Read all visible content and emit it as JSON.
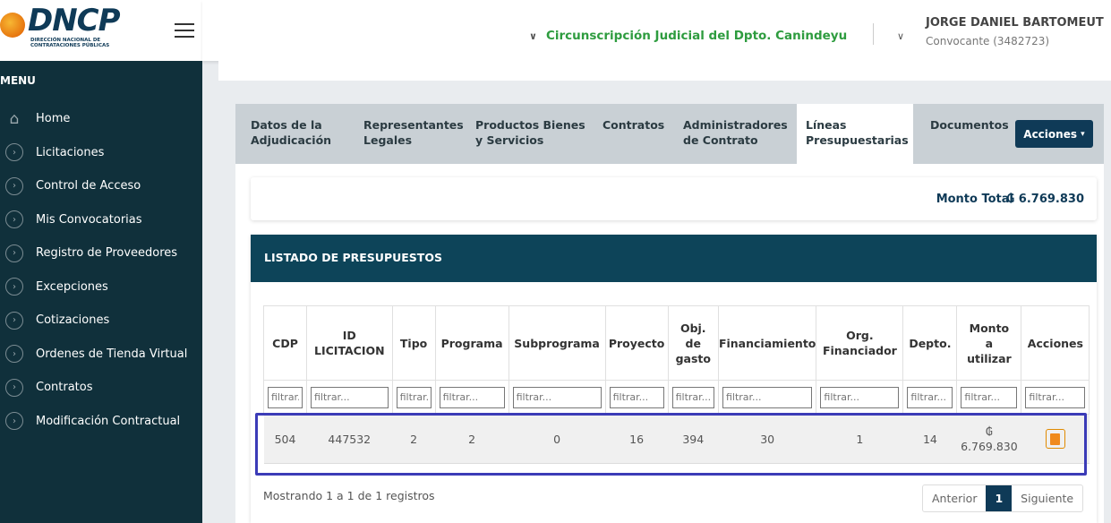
{
  "logo": {
    "title": "DNCP",
    "subtitle_line1": "DIRECCIÓN NACIONAL DE",
    "subtitle_line2": "CONTRATACIONES PÚBLICAS"
  },
  "sidebar": {
    "menu_label": "MENU",
    "items": [
      {
        "label": "Home",
        "icon": "home-icon"
      },
      {
        "label": "Licitaciones",
        "icon": "chevron-circle-icon"
      },
      {
        "label": "Control de Acceso",
        "icon": "chevron-circle-icon"
      },
      {
        "label": "Mis Convocatorias",
        "icon": "chevron-circle-icon"
      },
      {
        "label": "Registro de Proveedores",
        "icon": "chevron-circle-icon"
      },
      {
        "label": "Excepciones",
        "icon": "chevron-circle-icon"
      },
      {
        "label": "Cotizaciones",
        "icon": "chevron-circle-icon"
      },
      {
        "label": "Ordenes de Tienda Virtual",
        "icon": "chevron-circle-icon"
      },
      {
        "label": "Contratos",
        "icon": "chevron-circle-icon"
      },
      {
        "label": "Modificación Contractual",
        "icon": "chevron-circle-icon"
      }
    ]
  },
  "header": {
    "circunscripcion": "Circunscripción Judicial del Dpto. Canindeyu",
    "user_name": "JORGE DANIEL BARTOMEUT",
    "user_role": "Convocante (3482723)"
  },
  "tabs": [
    {
      "line1": "Datos de la",
      "line2": "Adjudicación"
    },
    {
      "line1": "Representantes",
      "line2": "Legales"
    },
    {
      "line1": "Productos Bienes",
      "line2": "y Servicios"
    },
    {
      "line1": "Contratos",
      "line2": ""
    },
    {
      "line1": "Administradores",
      "line2": "de Contrato"
    },
    {
      "line1": "Líneas",
      "line2": "Presupuestarias"
    },
    {
      "line1": "Documentos",
      "line2": ""
    }
  ],
  "acciones_button": "Acciones",
  "monto_total": {
    "label": "Monto Total",
    "value": "₲ 6.769.830"
  },
  "listado": {
    "title": "LISTADO DE PRESUPUESTOS",
    "columns": [
      "CDP",
      "ID LICITACION",
      "Tipo",
      "Programa",
      "Subprograma",
      "Proyecto",
      "Obj. de gasto",
      "Financiamiento",
      "Org. Financiador",
      "Depto.",
      "Monto a utilizar",
      "Acciones"
    ],
    "filter_placeholder": "filtrar...",
    "rows": [
      {
        "cdp": "504",
        "id_licitacion": "447532",
        "tipo": "2",
        "programa": "2",
        "subprograma": "0",
        "proyecto": "16",
        "obj_gasto": "394",
        "financiamiento": "30",
        "org_financiador": "1",
        "depto": "14",
        "monto_symbol": "₲",
        "monto": "6.769.830"
      }
    ],
    "footer": "Mostrando 1 a 1 de 1 registros",
    "pager": {
      "prev": "Anterior",
      "current": "1",
      "next": "Siguiente"
    }
  }
}
